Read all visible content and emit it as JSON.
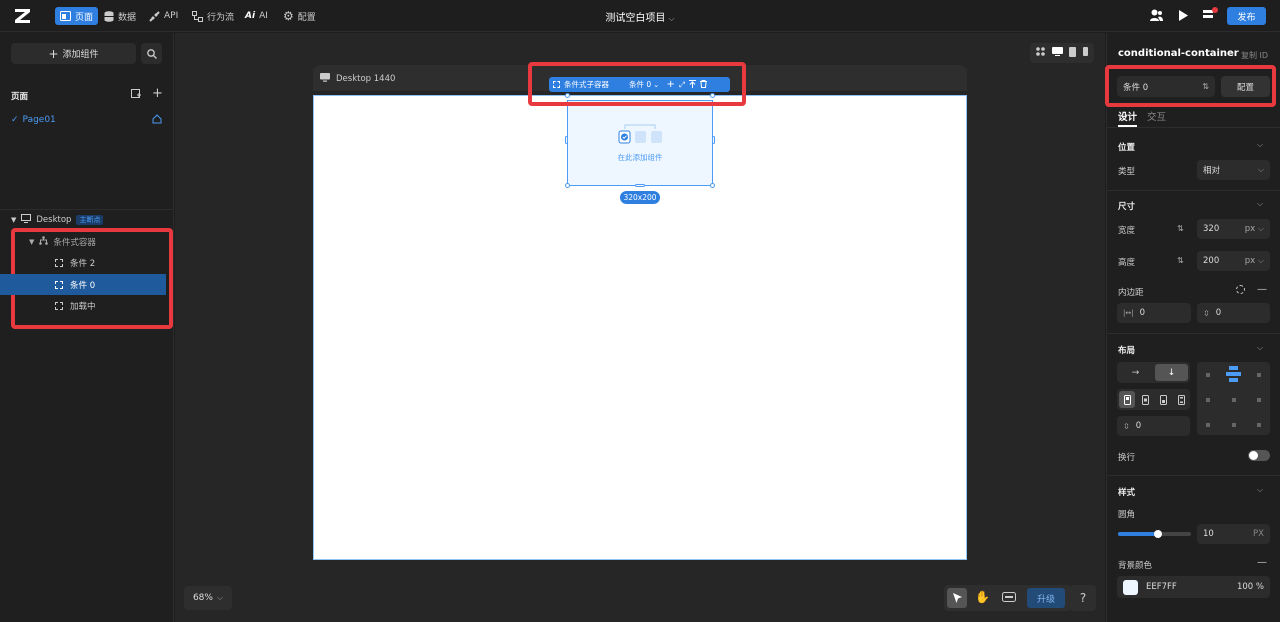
{
  "nav": {
    "pages": "页面",
    "data": "数据",
    "api": "API",
    "workflow": "行为流",
    "ai": "AI",
    "settings": "配置"
  },
  "project": {
    "title": "测试空白项目"
  },
  "publish": "发布",
  "left": {
    "add_component": "添加组件",
    "pages_title": "页面",
    "page_name": "Page01",
    "tree": {
      "desktop": "Desktop",
      "breakpoint_badge": "主断点",
      "conditional": "条件式容器",
      "items": [
        "条件 2",
        "条件 0",
        "加载中"
      ]
    }
  },
  "canvas": {
    "frame_label": "Desktop 1440",
    "toolbar_label": "条件式子容器",
    "toolbar_condition": "条件 0",
    "placeholder": "在此添加组件",
    "size_badge": "320x200",
    "zoom": "68%",
    "upgrade": "升级",
    "help": "?"
  },
  "right": {
    "component_name": "conditional-container",
    "copy_id": "复制 ID",
    "condition_select": "条件 0",
    "config_button": "配置",
    "tab_design": "设计",
    "tab_interact": "交互",
    "position": {
      "title": "位置",
      "type_label": "类型",
      "type_value": "相对"
    },
    "size": {
      "title": "尺寸",
      "width_label": "宽度",
      "width_value": "320",
      "width_unit": "px",
      "height_label": "高度",
      "height_value": "200",
      "height_unit": "px",
      "padding_label": "内边距",
      "padding_h": "0",
      "padding_v": "0"
    },
    "layout": {
      "title": "布局",
      "gap_value": "0",
      "wrap_label": "换行"
    },
    "style": {
      "title": "样式",
      "radius_label": "圆角",
      "radius_value": "10",
      "radius_unit": "PX",
      "radius_fill": 0.55,
      "bg_label": "背景颜色",
      "bg_value": "EEF7FF",
      "bg_opacity": "100 %"
    }
  },
  "colors": {
    "accent": "#2f7fe0",
    "highlight": "#e8393f",
    "bg_fill": "#EEF7FF"
  }
}
